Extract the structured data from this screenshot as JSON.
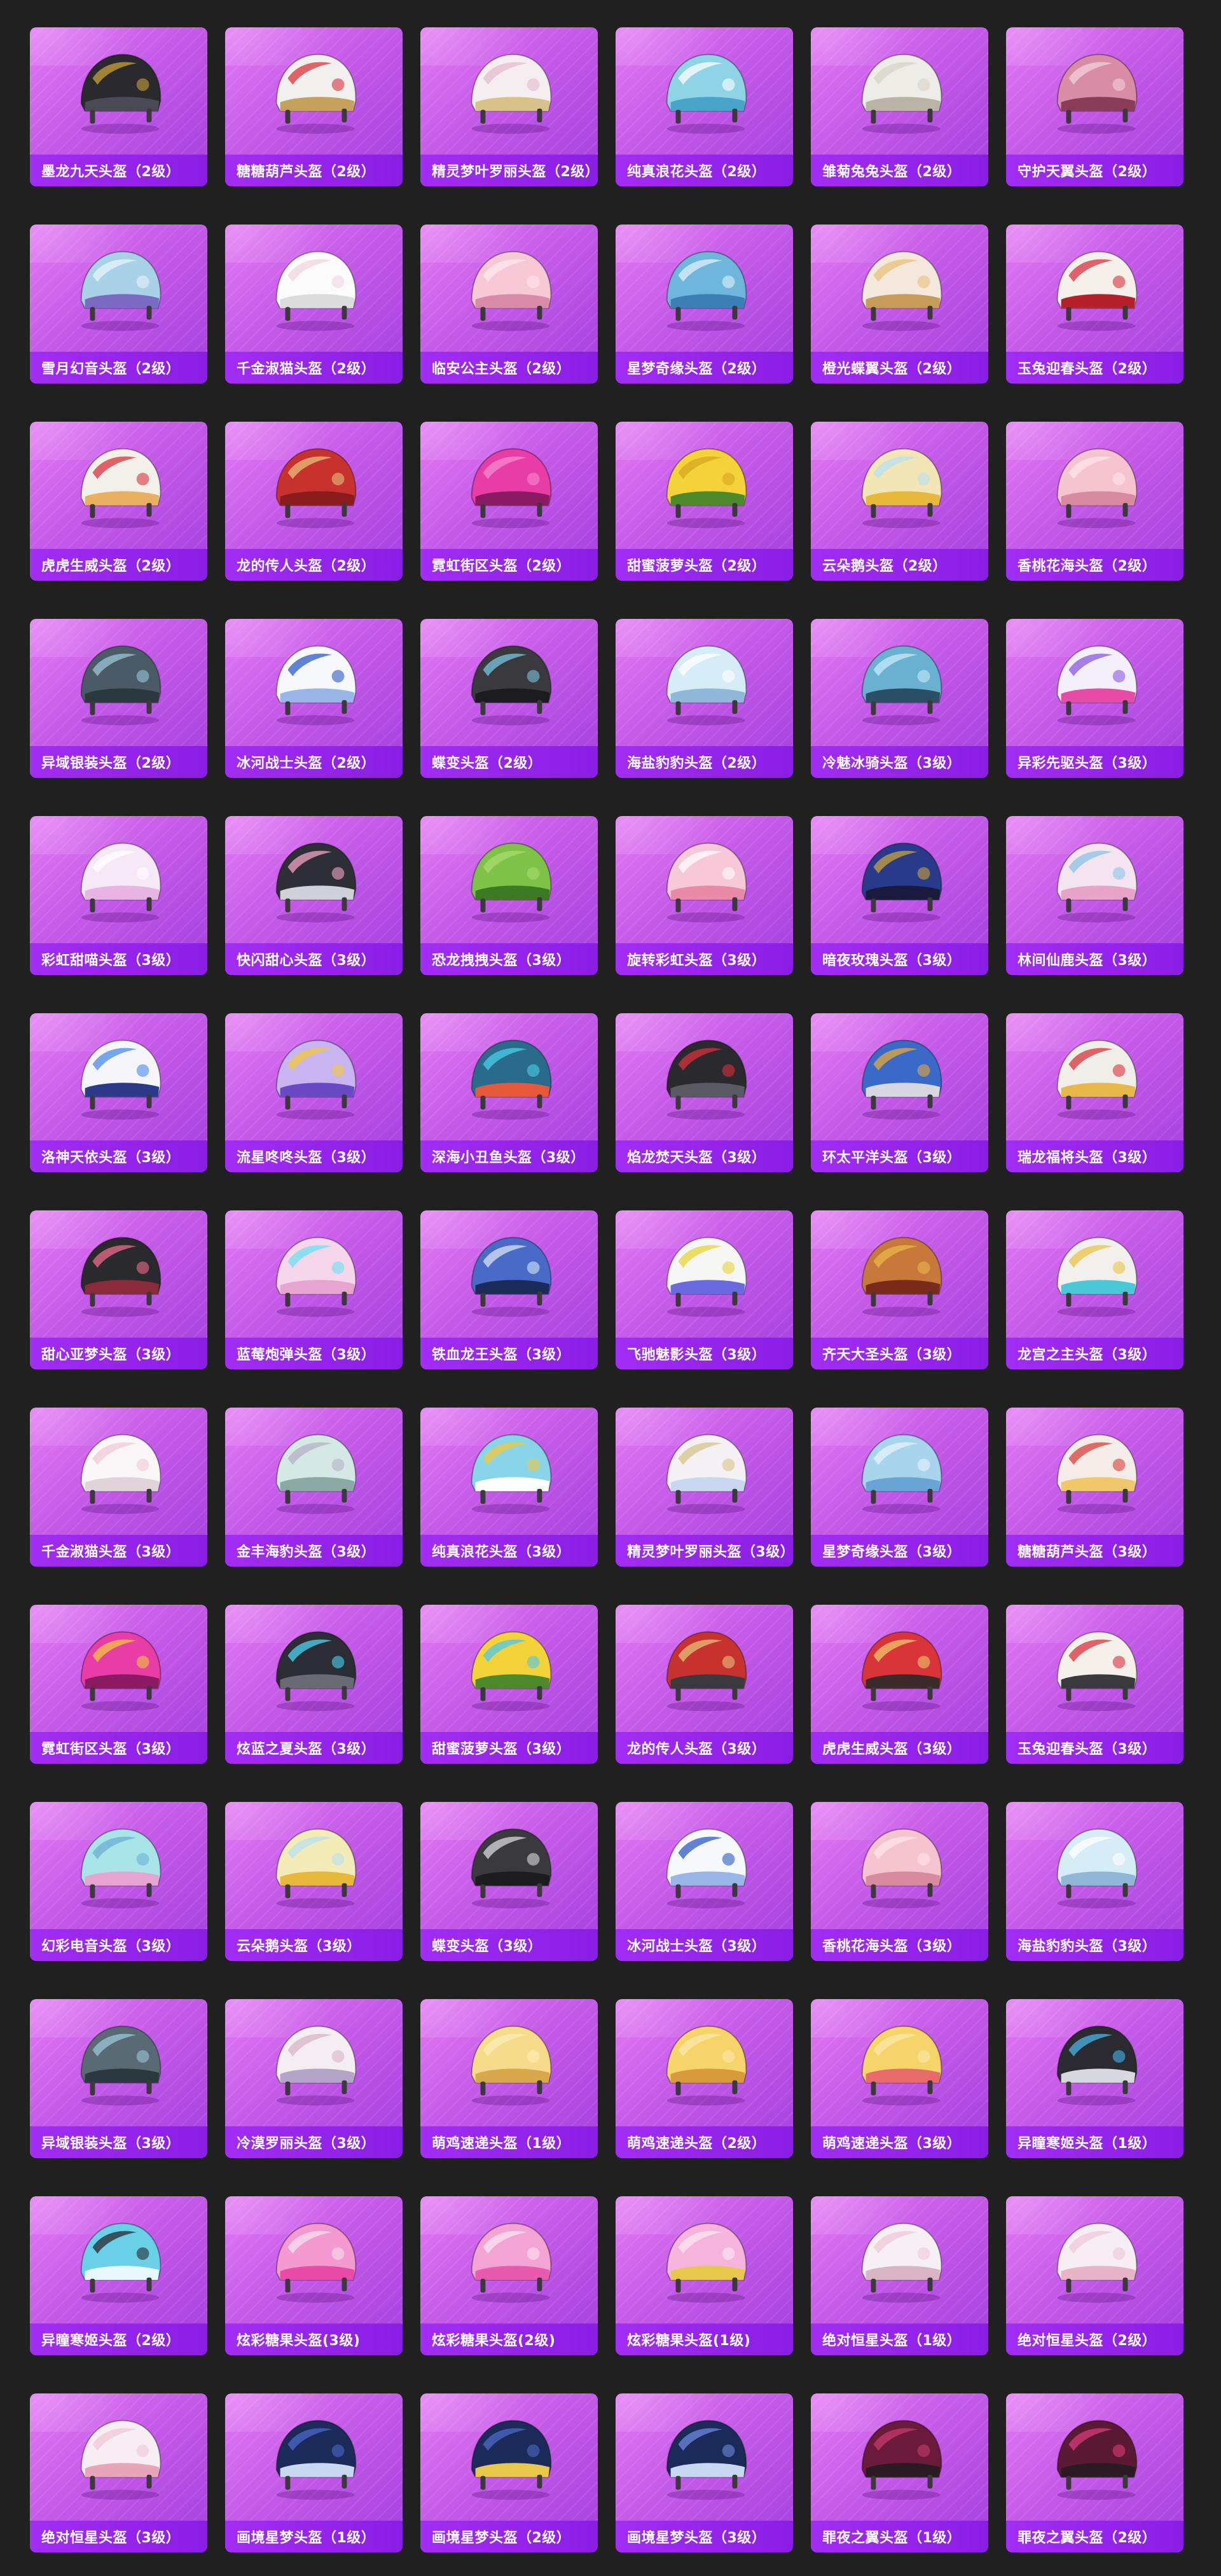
{
  "palette": {
    "page_bg": "#202020",
    "card_top": "#e47af4",
    "card_bottom": "#a53fe0",
    "label_bar": "#9a26ee",
    "label_text": "#ffffff"
  },
  "items": [
    {
      "label": "墨龙九天头盔（2级）",
      "icon": "helmet-icon",
      "colors": [
        "#2a2a2e",
        "#c9a23a",
        "#4a4a55"
      ]
    },
    {
      "label": "糖糖葫芦头盔（2级）",
      "icon": "helmet-icon",
      "colors": [
        "#f2f0ee",
        "#d8343a",
        "#c5a25c"
      ]
    },
    {
      "label": "精灵梦叶罗丽头盔（2级）",
      "icon": "helmet-icon",
      "colors": [
        "#f4eef0",
        "#e8b9d4",
        "#d9c28a"
      ]
    },
    {
      "label": "纯真浪花头盔（2级）",
      "icon": "helmet-icon",
      "colors": [
        "#8fd3e6",
        "#ffffff",
        "#4aa3c9"
      ]
    },
    {
      "label": "雏菊兔兔头盔（2级）",
      "icon": "helmet-icon",
      "colors": [
        "#eeece6",
        "#d8d4c8",
        "#b9b4a6"
      ]
    },
    {
      "label": "守护天翼头盔（2级）",
      "icon": "helmet-icon",
      "colors": [
        "#d98ca6",
        "#f0d0da",
        "#8a3c58"
      ]
    },
    {
      "label": "雪月幻音头盔（2级）",
      "icon": "helmet-icon",
      "colors": [
        "#a9d2e8",
        "#e8f4fa",
        "#7a6ac4"
      ]
    },
    {
      "label": "千金淑猫头盔（2级）",
      "icon": "helmet-icon",
      "colors": [
        "#fbfbfb",
        "#f0d6e2",
        "#dcdcdc"
      ]
    },
    {
      "label": "临安公主头盔（2级）",
      "icon": "helmet-icon",
      "colors": [
        "#f7c9d6",
        "#ffe8ef",
        "#d98aa8"
      ]
    },
    {
      "label": "星梦奇缘头盔（2级）",
      "icon": "helmet-icon",
      "colors": [
        "#6fb6dc",
        "#dff1fb",
        "#3b7fb6"
      ]
    },
    {
      "label": "橙光蝶翼头盔（2级）",
      "icon": "helmet-icon",
      "colors": [
        "#f4e8dc",
        "#e8c27a",
        "#c79c5a"
      ]
    },
    {
      "label": "玉兔迎春头盔（2级）",
      "icon": "helmet-icon",
      "colors": [
        "#f5f0ea",
        "#d8323c",
        "#b5202a"
      ]
    },
    {
      "label": "虎虎生威头盔（2级）",
      "icon": "helmet-icon",
      "colors": [
        "#f3f0ea",
        "#d8343a",
        "#e8b060"
      ]
    },
    {
      "label": "龙的传人头盔（2级）",
      "icon": "helmet-icon",
      "colors": [
        "#c8322e",
        "#e8c07a",
        "#8a1c1c"
      ]
    },
    {
      "label": "霓虹街区头盔（2级）",
      "icon": "helmet-icon",
      "colors": [
        "#e83ca6",
        "#f58ad0",
        "#8a1a62"
      ]
    },
    {
      "label": "甜蜜菠萝头盔（2级）",
      "icon": "helmet-icon",
      "colors": [
        "#f4d23a",
        "#d8a520",
        "#4c8a2c"
      ]
    },
    {
      "label": "云朵鹅头盔（2级）",
      "icon": "helmet-icon",
      "colors": [
        "#f2e6b6",
        "#b8e0f0",
        "#e8b83a"
      ]
    },
    {
      "label": "香桃花海头盔（2级）",
      "icon": "helmet-icon",
      "colors": [
        "#f6c4cf",
        "#ffe4ea",
        "#d88aa0"
      ]
    },
    {
      "label": "异域银装头盔（2级）",
      "icon": "helmet-icon",
      "colors": [
        "#4a5a66",
        "#9ac8d8",
        "#2b3840"
      ]
    },
    {
      "label": "冰河战士头盔（2级）",
      "icon": "helmet-icon",
      "colors": [
        "#f6f8fb",
        "#2c5cc4",
        "#9ab6e8"
      ]
    },
    {
      "label": "蝶变头盔（2级）",
      "icon": "helmet-icon",
      "colors": [
        "#3a3a3e",
        "#7ac4e0",
        "#1c1c20"
      ]
    },
    {
      "label": "海盐豹豹头盔（2级）",
      "icon": "helmet-icon",
      "colors": [
        "#d6ecf7",
        "#ffffff",
        "#8fb8d8"
      ]
    },
    {
      "label": "冷魅冰骑头盔（3级）",
      "icon": "helmet-icon",
      "colors": [
        "#6ab0d0",
        "#c8ecf8",
        "#2a4e66"
      ]
    },
    {
      "label": "异彩先驱头盔（3级）",
      "icon": "helmet-icon",
      "colors": [
        "#f4f0fb",
        "#8a5ae0",
        "#e84aa8"
      ]
    },
    {
      "label": "彩虹甜喵头盔（3级）",
      "icon": "helmet-icon",
      "colors": [
        "#f6e8f6",
        "#ffffff",
        "#e8b4e4"
      ]
    },
    {
      "label": "快闪甜心头盔（3级）",
      "icon": "helmet-icon",
      "colors": [
        "#2e2e36",
        "#f3a6c4",
        "#d0d0d8"
      ]
    },
    {
      "label": "恐龙拽拽头盔（3级）",
      "icon": "helmet-icon",
      "colors": [
        "#7ec24a",
        "#a8dc6c",
        "#3e7a24"
      ]
    },
    {
      "label": "旋转彩虹头盔（3级）",
      "icon": "helmet-icon",
      "colors": [
        "#f6c8d8",
        "#ffffff",
        "#e88aa8"
      ]
    },
    {
      "label": "暗夜玫瑰头盔（3级）",
      "icon": "helmet-icon",
      "colors": [
        "#2a3a8a",
        "#c8a43a",
        "#1a1a3e"
      ]
    },
    {
      "label": "林间仙鹿头盔（3级）",
      "icon": "helmet-icon",
      "colors": [
        "#f4e4f0",
        "#8ac4e8",
        "#e8a4c8"
      ]
    },
    {
      "label": "洛神天依头盔（3级）",
      "icon": "helmet-icon",
      "colors": [
        "#f6f6fa",
        "#4a8ae8",
        "#2c3a8a"
      ]
    },
    {
      "label": "流星咚咚头盔（3级）",
      "icon": "helmet-icon",
      "colors": [
        "#c8b4f0",
        "#f0c83a",
        "#6a4ac4"
      ]
    },
    {
      "label": "深海小丑鱼头盔（3级）",
      "icon": "helmet-icon",
      "colors": [
        "#2a6a8a",
        "#4ad0e8",
        "#e8583a"
      ]
    },
    {
      "label": "焰龙焚天头盔（3级）",
      "icon": "helmet-icon",
      "colors": [
        "#2a2a2e",
        "#d8303a",
        "#5a5a62"
      ]
    },
    {
      "label": "环太平洋头盔（3级）",
      "icon": "helmet-icon",
      "colors": [
        "#3a6ac8",
        "#e8a83a",
        "#d8d8e0"
      ]
    },
    {
      "label": "瑞龙福将头盔（3级）",
      "icon": "helmet-icon",
      "colors": [
        "#f0eee8",
        "#d8343a",
        "#e8b84a"
      ]
    },
    {
      "label": "甜心亚梦头盔（3级）",
      "icon": "helmet-icon",
      "colors": [
        "#2a2a2e",
        "#f06a8a",
        "#8a2a3a"
      ]
    },
    {
      "label": "蓝莓炮弹头盔（3级）",
      "icon": "helmet-icon",
      "colors": [
        "#f6d6ea",
        "#6ae0f0",
        "#e8a4d0"
      ]
    },
    {
      "label": "铁血龙王头盔（3级）",
      "icon": "helmet-icon",
      "colors": [
        "#4a6ac8",
        "#d8e4f8",
        "#1c2a5a"
      ]
    },
    {
      "label": "飞驰魅影头盔（3级）",
      "icon": "helmet-icon",
      "colors": [
        "#f6f6f4",
        "#e8d43a",
        "#6a6ae0"
      ]
    },
    {
      "label": "齐天大圣头盔（3级）",
      "icon": "helmet-icon",
      "colors": [
        "#c8783a",
        "#e8b84a",
        "#7a2c1c"
      ]
    },
    {
      "label": "龙宫之主头盔（3级）",
      "icon": "helmet-icon",
      "colors": [
        "#f2f0ec",
        "#e8c44a",
        "#4ac8d8"
      ]
    },
    {
      "label": "千金淑猫头盔（3级）",
      "icon": "helmet-icon",
      "colors": [
        "#fbf6f8",
        "#f0cad8",
        "#e0d4da"
      ]
    },
    {
      "label": "金丰海豹头盔（3级）",
      "icon": "helmet-icon",
      "colors": [
        "#d4e8e4",
        "#b8b0c8",
        "#8aa8a4"
      ]
    },
    {
      "label": "纯真浪花头盔（3级）",
      "icon": "helmet-icon",
      "colors": [
        "#8ad4e8",
        "#f0c83a",
        "#ffffff"
      ]
    },
    {
      "label": "精灵梦叶罗丽头盔（3级）",
      "icon": "helmet-icon",
      "colors": [
        "#f4f0f4",
        "#d8c48a",
        "#c8d8f0"
      ]
    },
    {
      "label": "星梦奇缘头盔（3级）",
      "icon": "helmet-icon",
      "colors": [
        "#a8d4ee",
        "#e8f4fb",
        "#6aa4d4"
      ]
    },
    {
      "label": "糖糖葫芦头盔（3级）",
      "icon": "helmet-icon",
      "colors": [
        "#f4ece6",
        "#d8403a",
        "#f0c86a"
      ]
    },
    {
      "label": "霓虹街区头盔（3级）",
      "icon": "helmet-icon",
      "colors": [
        "#e83ca6",
        "#f0c83a",
        "#8a1a62"
      ]
    },
    {
      "label": "炫蓝之夏头盔（3级）",
      "icon": "helmet-icon",
      "colors": [
        "#2c2c34",
        "#4ad4f0",
        "#6a6a74"
      ]
    },
    {
      "label": "甜蜜菠萝头盔（3级）",
      "icon": "helmet-icon",
      "colors": [
        "#f4d23a",
        "#4ac8f0",
        "#4c8a2c"
      ]
    },
    {
      "label": "龙的传人头盔（3级）",
      "icon": "helmet-icon",
      "colors": [
        "#c8322e",
        "#e8c07a",
        "#3a3a3e"
      ]
    },
    {
      "label": "虎虎生威头盔（3级）",
      "icon": "helmet-icon",
      "colors": [
        "#d8343a",
        "#f0c86a",
        "#3a2a2a"
      ]
    },
    {
      "label": "玉兔迎春头盔（3级）",
      "icon": "helmet-icon",
      "colors": [
        "#f5f0ea",
        "#d8323c",
        "#3a3a3e"
      ]
    },
    {
      "label": "幻彩电音头盔（3级）",
      "icon": "helmet-icon",
      "colors": [
        "#a8e4e8",
        "#6ab0d0",
        "#e8a4d0"
      ]
    },
    {
      "label": "云朵鹅头盔（3级）",
      "icon": "helmet-icon",
      "colors": [
        "#f4ecb8",
        "#b8e0f0",
        "#e8b83a"
      ]
    },
    {
      "label": "蝶变头盔（3级）",
      "icon": "helmet-icon",
      "colors": [
        "#3a3a3e",
        "#d8d8e0",
        "#1c1c20"
      ]
    },
    {
      "label": "冰河战士头盔（3级）",
      "icon": "helmet-icon",
      "colors": [
        "#f6f8fb",
        "#2c5cc4",
        "#9ab6e8"
      ]
    },
    {
      "label": "香桃花海头盔（3级）",
      "icon": "helmet-icon",
      "colors": [
        "#f6c4cf",
        "#ffe4ea",
        "#d88aa0"
      ]
    },
    {
      "label": "海盐豹豹头盔（3级）",
      "icon": "helmet-icon",
      "colors": [
        "#d6ecf7",
        "#ffffff",
        "#8fb8d8"
      ]
    },
    {
      "label": "异域银装头盔（3级）",
      "icon": "helmet-icon",
      "colors": [
        "#5a6a74",
        "#9ac8d8",
        "#2b3840"
      ]
    },
    {
      "label": "冷漠罗丽头盔（3级）",
      "icon": "helmet-icon",
      "colors": [
        "#f4eef2",
        "#d8b4c8",
        "#b4a4c8"
      ]
    },
    {
      "label": "萌鸡速递头盔（1级）",
      "icon": "helmet-icon",
      "colors": [
        "#f6dc8a",
        "#fbeeb8",
        "#d8a84a"
      ]
    },
    {
      "label": "萌鸡速递头盔（2级）",
      "icon": "helmet-icon",
      "colors": [
        "#f6d46a",
        "#fbe8a8",
        "#d89a3a"
      ]
    },
    {
      "label": "萌鸡速递头盔（3级）",
      "icon": "helmet-icon",
      "colors": [
        "#f6d46a",
        "#fbe8a8",
        "#e86a6a"
      ]
    },
    {
      "label": "异瞳寒姬头盔（1级）",
      "icon": "helmet-icon",
      "colors": [
        "#2a2a30",
        "#4ab4e8",
        "#d8d8e0"
      ]
    },
    {
      "label": "异瞳寒姬头盔（2级）",
      "icon": "helmet-icon",
      "colors": [
        "#6ad0e8",
        "#2a2a30",
        "#e8f8fb"
      ]
    },
    {
      "label": "炫彩糖果头盔(3级)",
      "icon": "helmet-icon",
      "colors": [
        "#f49ad0",
        "#f6e0f0",
        "#e84aa8"
      ]
    },
    {
      "label": "炫彩糖果头盔(2级)",
      "icon": "helmet-icon",
      "colors": [
        "#f4a4d4",
        "#fbe4f2",
        "#e85aae"
      ]
    },
    {
      "label": "炫彩糖果头盔(1级)",
      "icon": "helmet-icon",
      "colors": [
        "#f6b4dc",
        "#fbe8f4",
        "#e8c84a"
      ]
    },
    {
      "label": "绝对恒星头盔（1级）",
      "icon": "helmet-icon",
      "colors": [
        "#f6f0f4",
        "#f0c8d8",
        "#d8b4c4"
      ]
    },
    {
      "label": "绝对恒星头盔（2级）",
      "icon": "helmet-icon",
      "colors": [
        "#f6eef2",
        "#f0c8d8",
        "#e8b4c8"
      ]
    },
    {
      "label": "绝对恒星头盔（3级）",
      "icon": "helmet-icon",
      "colors": [
        "#f6eef2",
        "#f0c8d8",
        "#e8a4b8"
      ]
    },
    {
      "label": "画境星梦头盔（1级）",
      "icon": "helmet-icon",
      "colors": [
        "#1c2a5a",
        "#4a6ac8",
        "#c8d8f0"
      ]
    },
    {
      "label": "画境星梦头盔（2级）",
      "icon": "helmet-icon",
      "colors": [
        "#1c2a5a",
        "#4a6ac8",
        "#e8c84a"
      ]
    },
    {
      "label": "画境星梦头盔（3级）",
      "icon": "helmet-icon",
      "colors": [
        "#1c2a5a",
        "#6a8ae0",
        "#c8d8f0"
      ]
    },
    {
      "label": "罪夜之翼头盔（1级）",
      "icon": "helmet-icon",
      "colors": [
        "#6a1a3a",
        "#c83a6a",
        "#2a1a24"
      ]
    },
    {
      "label": "罪夜之翼头盔（2级）",
      "icon": "helmet-icon",
      "colors": [
        "#5a1a34",
        "#d83a7a",
        "#2a1a24"
      ]
    }
  ]
}
